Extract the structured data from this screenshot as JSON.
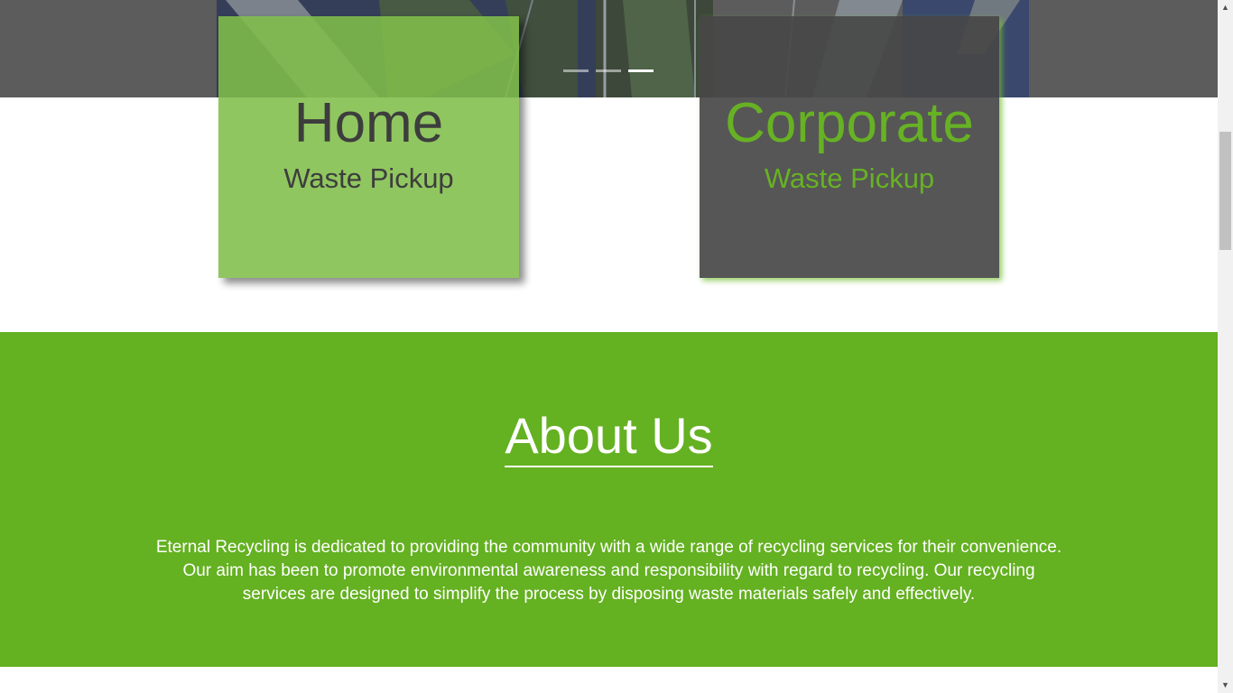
{
  "hero": {
    "slide_count": 3,
    "active_slide": 3
  },
  "cards": [
    {
      "title": "Home",
      "subtitle": "Waste Pickup"
    },
    {
      "title": "Corporate",
      "subtitle": "Waste Pickup"
    }
  ],
  "about": {
    "title": "About Us",
    "text": "Eternal Recycling is dedicated to providing the community with a wide range of recycling services for their convenience. Our aim has been to promote environmental awareness and responsibility with regard to recycling. Our recycling services are designed to simplify the process by disposing waste materials safely and effectively."
  },
  "colors": {
    "brand_green": "#64b121",
    "card_green": "#8ac45a",
    "card_dark": "#484848"
  },
  "scrollbar": {
    "up_icon": "triangle-up-icon",
    "down_icon": "triangle-down-icon"
  }
}
